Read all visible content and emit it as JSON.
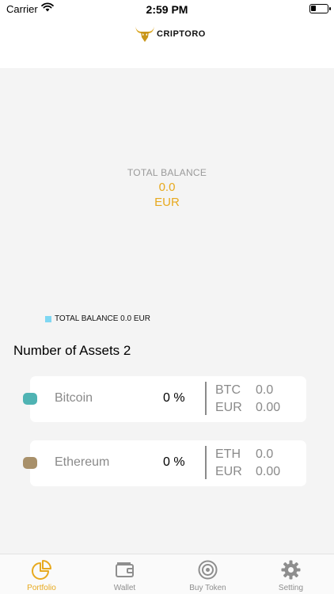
{
  "status_bar": {
    "carrier": "Carrier",
    "time": "2:59 PM"
  },
  "header": {
    "logo_text": "CRIPTORO"
  },
  "balance": {
    "label": "TOTAL BALANCE",
    "value": "0.0",
    "currency": "EUR"
  },
  "legend": {
    "text": "TOTAL BALANCE 0.0 EUR",
    "color": "#7fd7f2"
  },
  "assets": {
    "count_label": "Number of Assets 2",
    "items": [
      {
        "name": "Bitcoin",
        "percent": "0 %",
        "code": "BTC",
        "amount": "0.0",
        "fiat": "EUR",
        "fiat_amount": "0.00",
        "color": "#4fb3b3"
      },
      {
        "name": "Ethereum",
        "percent": "0 %",
        "code": "ETH",
        "amount": "0.0",
        "fiat": "EUR",
        "fiat_amount": "0.00",
        "color": "#a8906a"
      }
    ]
  },
  "tabbar": {
    "tabs": [
      {
        "label": "Portfolio",
        "icon": "pie-chart-icon",
        "active": true
      },
      {
        "label": "Wallet",
        "icon": "wallet-icon",
        "active": false
      },
      {
        "label": "Buy Token",
        "icon": "target-icon",
        "active": false
      },
      {
        "label": "Setting",
        "icon": "gear-icon",
        "active": false
      }
    ]
  },
  "colors": {
    "accent": "#e7a91e",
    "muted": "#8a8a8a"
  }
}
